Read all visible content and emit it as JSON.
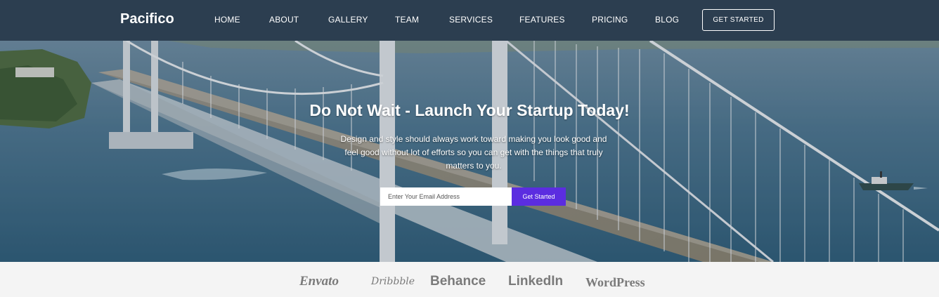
{
  "header": {
    "brand": "Pacifico",
    "nav": [
      "HOME",
      "ABOUT",
      "GALLERY",
      "TEAM",
      "SERVICES",
      "FEATURES",
      "PRICING",
      "BLOG"
    ],
    "cta": "GET STARTED"
  },
  "hero": {
    "title": "Do Not Wait - Launch Your Startup Today!",
    "subtitle": "Design and style should always work toward making you look good and feel good without lot of efforts so you can get with the things that truly matters to you.",
    "email_placeholder": "Enter Your Email Address",
    "submit_label": "Get Started"
  },
  "brands": [
    "Envato",
    "Dribbble",
    "Behance",
    "LinkedIn",
    "WordPress"
  ],
  "colors": {
    "nav_bg": "#2c3e50",
    "accent": "#5b2de0",
    "brand_text": "#7a7a7a"
  }
}
